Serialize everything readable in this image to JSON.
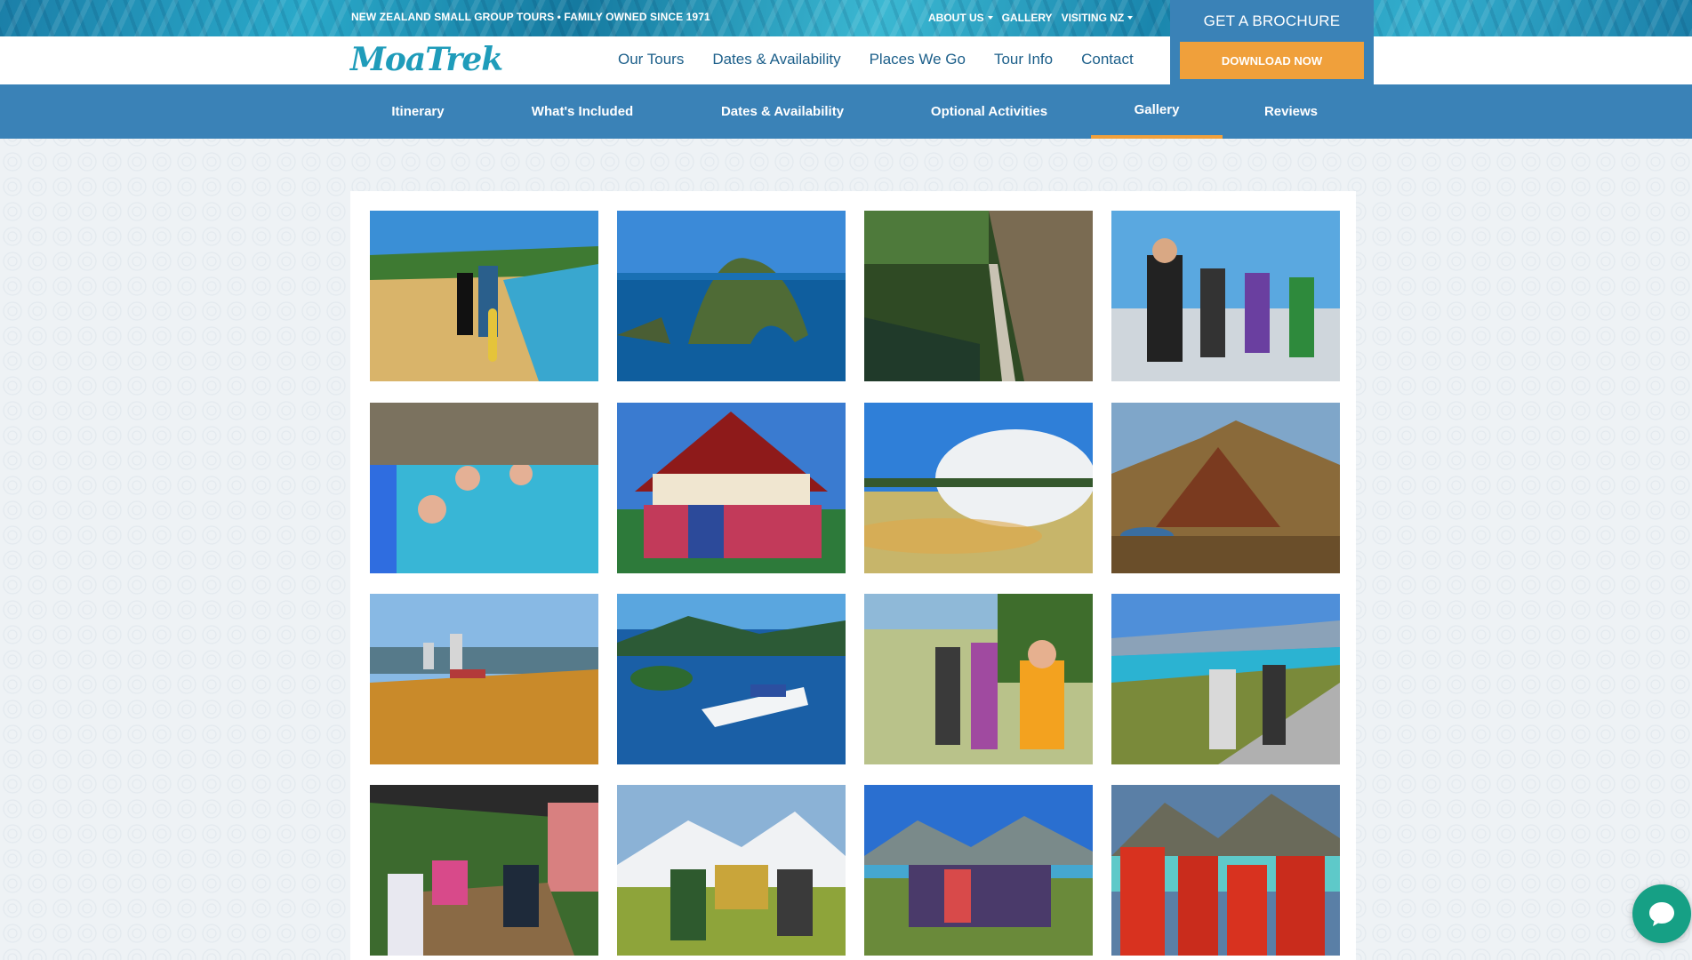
{
  "topbar": {
    "tagline": "NEW ZEALAND SMALL GROUP TOURS • FAMILY OWNED SINCE 1971",
    "links": [
      {
        "label": "ABOUT US",
        "has_dropdown": true
      },
      {
        "label": "GALLERY",
        "has_dropdown": false
      },
      {
        "label": "VISITING NZ",
        "has_dropdown": true
      }
    ]
  },
  "brand": {
    "logo_text": "MoaTrek",
    "logo_color": "#1f9cba"
  },
  "main_nav": [
    "Our Tours",
    "Dates & Availability",
    "Places We Go",
    "Tour Info",
    "Contact"
  ],
  "brochure": {
    "title": "GET A BROCHURE",
    "button": "DOWNLOAD NOW"
  },
  "tour_nav": {
    "items": [
      "Itinerary",
      "What's Included",
      "Dates & Availability",
      "Optional Activities",
      "Gallery",
      "Reviews"
    ],
    "active": "Gallery"
  },
  "gallery": {
    "photos": [
      {
        "subject": "beach couple with boogie board"
      },
      {
        "subject": "rock arch island in ocean"
      },
      {
        "subject": "hikers on cliff walkway"
      },
      {
        "subject": "group on boat deck"
      },
      {
        "subject": "people in hot pool"
      },
      {
        "subject": "group at carved marae"
      },
      {
        "subject": "geothermal steam pool"
      },
      {
        "subject": "volcanic crater and lakes"
      },
      {
        "subject": "city view with golden grass"
      },
      {
        "subject": "ferry in sounds"
      },
      {
        "subject": "group on coastal path"
      },
      {
        "subject": "group at coastal roadside"
      },
      {
        "subject": "group dining under umbrella"
      },
      {
        "subject": "group at national park sign"
      },
      {
        "subject": "group near mountain lake"
      },
      {
        "subject": "group in life jackets"
      }
    ]
  },
  "colors": {
    "primary_blue": "#3a82b7",
    "accent_orange": "#f0a03b",
    "nav_text": "#1c5f8a"
  },
  "chat": {
    "icon": "chat-bubble-icon"
  }
}
